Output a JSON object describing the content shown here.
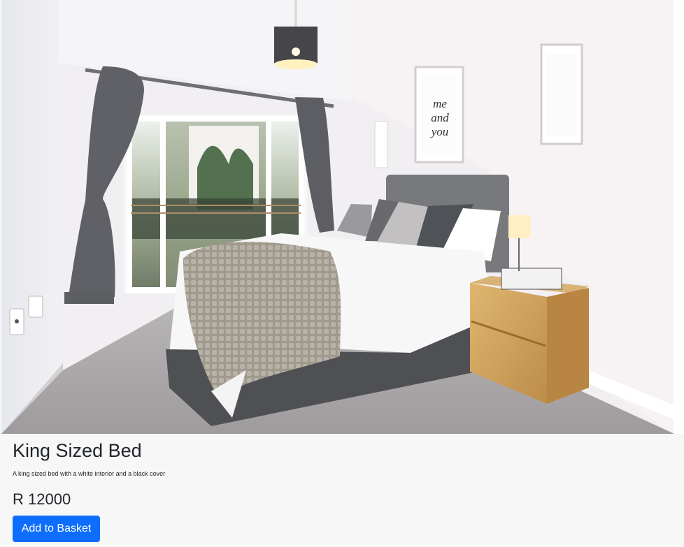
{
  "product": {
    "image_alt": "Bedroom with a king sized bed",
    "title": "King Sized Bed",
    "description": "A king sized bed with a white interior and a black cover",
    "price": "R 12000",
    "button_label": "Add to Basket"
  },
  "colors": {
    "button": "#0d6efd",
    "card_background": "#f7f7f7",
    "text": "#212529"
  },
  "artwork": {
    "poster_text": [
      "me",
      "and",
      "you"
    ]
  }
}
